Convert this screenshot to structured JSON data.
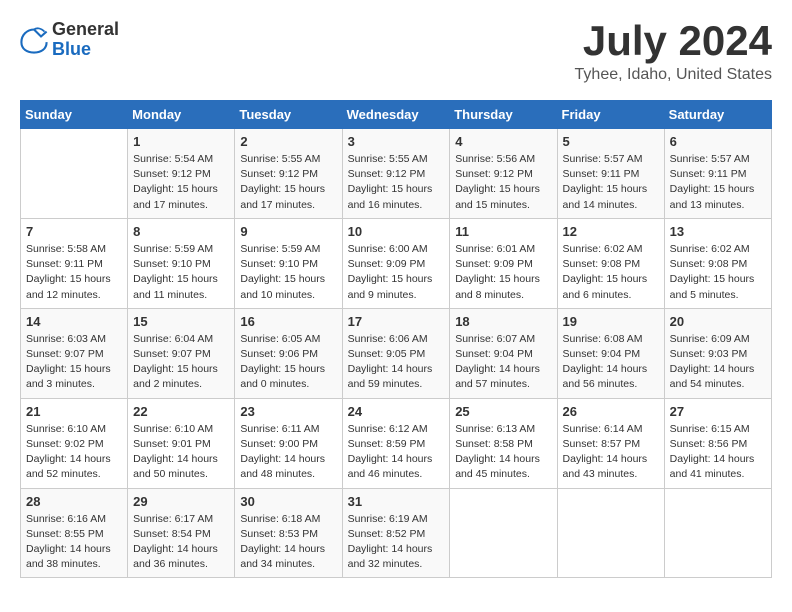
{
  "header": {
    "logo": {
      "general": "General",
      "blue": "Blue"
    },
    "title": "July 2024",
    "location": "Tyhee, Idaho, United States"
  },
  "calendar": {
    "weekdays": [
      "Sunday",
      "Monday",
      "Tuesday",
      "Wednesday",
      "Thursday",
      "Friday",
      "Saturday"
    ],
    "weeks": [
      [
        {
          "day": "",
          "data": ""
        },
        {
          "day": "1",
          "data": "Sunrise: 5:54 AM\nSunset: 9:12 PM\nDaylight: 15 hours\nand 17 minutes."
        },
        {
          "day": "2",
          "data": "Sunrise: 5:55 AM\nSunset: 9:12 PM\nDaylight: 15 hours\nand 17 minutes."
        },
        {
          "day": "3",
          "data": "Sunrise: 5:55 AM\nSunset: 9:12 PM\nDaylight: 15 hours\nand 16 minutes."
        },
        {
          "day": "4",
          "data": "Sunrise: 5:56 AM\nSunset: 9:12 PM\nDaylight: 15 hours\nand 15 minutes."
        },
        {
          "day": "5",
          "data": "Sunrise: 5:57 AM\nSunset: 9:11 PM\nDaylight: 15 hours\nand 14 minutes."
        },
        {
          "day": "6",
          "data": "Sunrise: 5:57 AM\nSunset: 9:11 PM\nDaylight: 15 hours\nand 13 minutes."
        }
      ],
      [
        {
          "day": "7",
          "data": "Sunrise: 5:58 AM\nSunset: 9:11 PM\nDaylight: 15 hours\nand 12 minutes."
        },
        {
          "day": "8",
          "data": "Sunrise: 5:59 AM\nSunset: 9:10 PM\nDaylight: 15 hours\nand 11 minutes."
        },
        {
          "day": "9",
          "data": "Sunrise: 5:59 AM\nSunset: 9:10 PM\nDaylight: 15 hours\nand 10 minutes."
        },
        {
          "day": "10",
          "data": "Sunrise: 6:00 AM\nSunset: 9:09 PM\nDaylight: 15 hours\nand 9 minutes."
        },
        {
          "day": "11",
          "data": "Sunrise: 6:01 AM\nSunset: 9:09 PM\nDaylight: 15 hours\nand 8 minutes."
        },
        {
          "day": "12",
          "data": "Sunrise: 6:02 AM\nSunset: 9:08 PM\nDaylight: 15 hours\nand 6 minutes."
        },
        {
          "day": "13",
          "data": "Sunrise: 6:02 AM\nSunset: 9:08 PM\nDaylight: 15 hours\nand 5 minutes."
        }
      ],
      [
        {
          "day": "14",
          "data": "Sunrise: 6:03 AM\nSunset: 9:07 PM\nDaylight: 15 hours\nand 3 minutes."
        },
        {
          "day": "15",
          "data": "Sunrise: 6:04 AM\nSunset: 9:07 PM\nDaylight: 15 hours\nand 2 minutes."
        },
        {
          "day": "16",
          "data": "Sunrise: 6:05 AM\nSunset: 9:06 PM\nDaylight: 15 hours\nand 0 minutes."
        },
        {
          "day": "17",
          "data": "Sunrise: 6:06 AM\nSunset: 9:05 PM\nDaylight: 14 hours\nand 59 minutes."
        },
        {
          "day": "18",
          "data": "Sunrise: 6:07 AM\nSunset: 9:04 PM\nDaylight: 14 hours\nand 57 minutes."
        },
        {
          "day": "19",
          "data": "Sunrise: 6:08 AM\nSunset: 9:04 PM\nDaylight: 14 hours\nand 56 minutes."
        },
        {
          "day": "20",
          "data": "Sunrise: 6:09 AM\nSunset: 9:03 PM\nDaylight: 14 hours\nand 54 minutes."
        }
      ],
      [
        {
          "day": "21",
          "data": "Sunrise: 6:10 AM\nSunset: 9:02 PM\nDaylight: 14 hours\nand 52 minutes."
        },
        {
          "day": "22",
          "data": "Sunrise: 6:10 AM\nSunset: 9:01 PM\nDaylight: 14 hours\nand 50 minutes."
        },
        {
          "day": "23",
          "data": "Sunrise: 6:11 AM\nSunset: 9:00 PM\nDaylight: 14 hours\nand 48 minutes."
        },
        {
          "day": "24",
          "data": "Sunrise: 6:12 AM\nSunset: 8:59 PM\nDaylight: 14 hours\nand 46 minutes."
        },
        {
          "day": "25",
          "data": "Sunrise: 6:13 AM\nSunset: 8:58 PM\nDaylight: 14 hours\nand 45 minutes."
        },
        {
          "day": "26",
          "data": "Sunrise: 6:14 AM\nSunset: 8:57 PM\nDaylight: 14 hours\nand 43 minutes."
        },
        {
          "day": "27",
          "data": "Sunrise: 6:15 AM\nSunset: 8:56 PM\nDaylight: 14 hours\nand 41 minutes."
        }
      ],
      [
        {
          "day": "28",
          "data": "Sunrise: 6:16 AM\nSunset: 8:55 PM\nDaylight: 14 hours\nand 38 minutes."
        },
        {
          "day": "29",
          "data": "Sunrise: 6:17 AM\nSunset: 8:54 PM\nDaylight: 14 hours\nand 36 minutes."
        },
        {
          "day": "30",
          "data": "Sunrise: 6:18 AM\nSunset: 8:53 PM\nDaylight: 14 hours\nand 34 minutes."
        },
        {
          "day": "31",
          "data": "Sunrise: 6:19 AM\nSunset: 8:52 PM\nDaylight: 14 hours\nand 32 minutes."
        },
        {
          "day": "",
          "data": ""
        },
        {
          "day": "",
          "data": ""
        },
        {
          "day": "",
          "data": ""
        }
      ]
    ]
  }
}
